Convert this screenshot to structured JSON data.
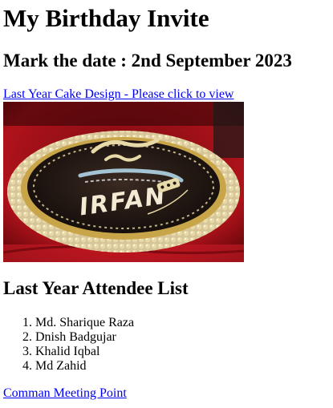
{
  "page": {
    "title": "My Birthday Invite",
    "date_heading": "Mark the date : 2nd September 2023"
  },
  "cake": {
    "link_label": "Last Year Cake Design - Please click to view",
    "name_on_cake": "IRFAN",
    "colors": {
      "tablecloth": "#b0121a",
      "cake_dark": "#1c1410",
      "cream": "#e8d9a8",
      "edge_gold": "#c9a54a"
    }
  },
  "attendees": {
    "heading": "Last Year Attendee List",
    "items": [
      "Md. Sharique Raza",
      "Dnish Badgujar",
      "Khalid Iqbal",
      "Md Zahid"
    ]
  },
  "meeting": {
    "link_label": "Comman Meeting Point"
  }
}
